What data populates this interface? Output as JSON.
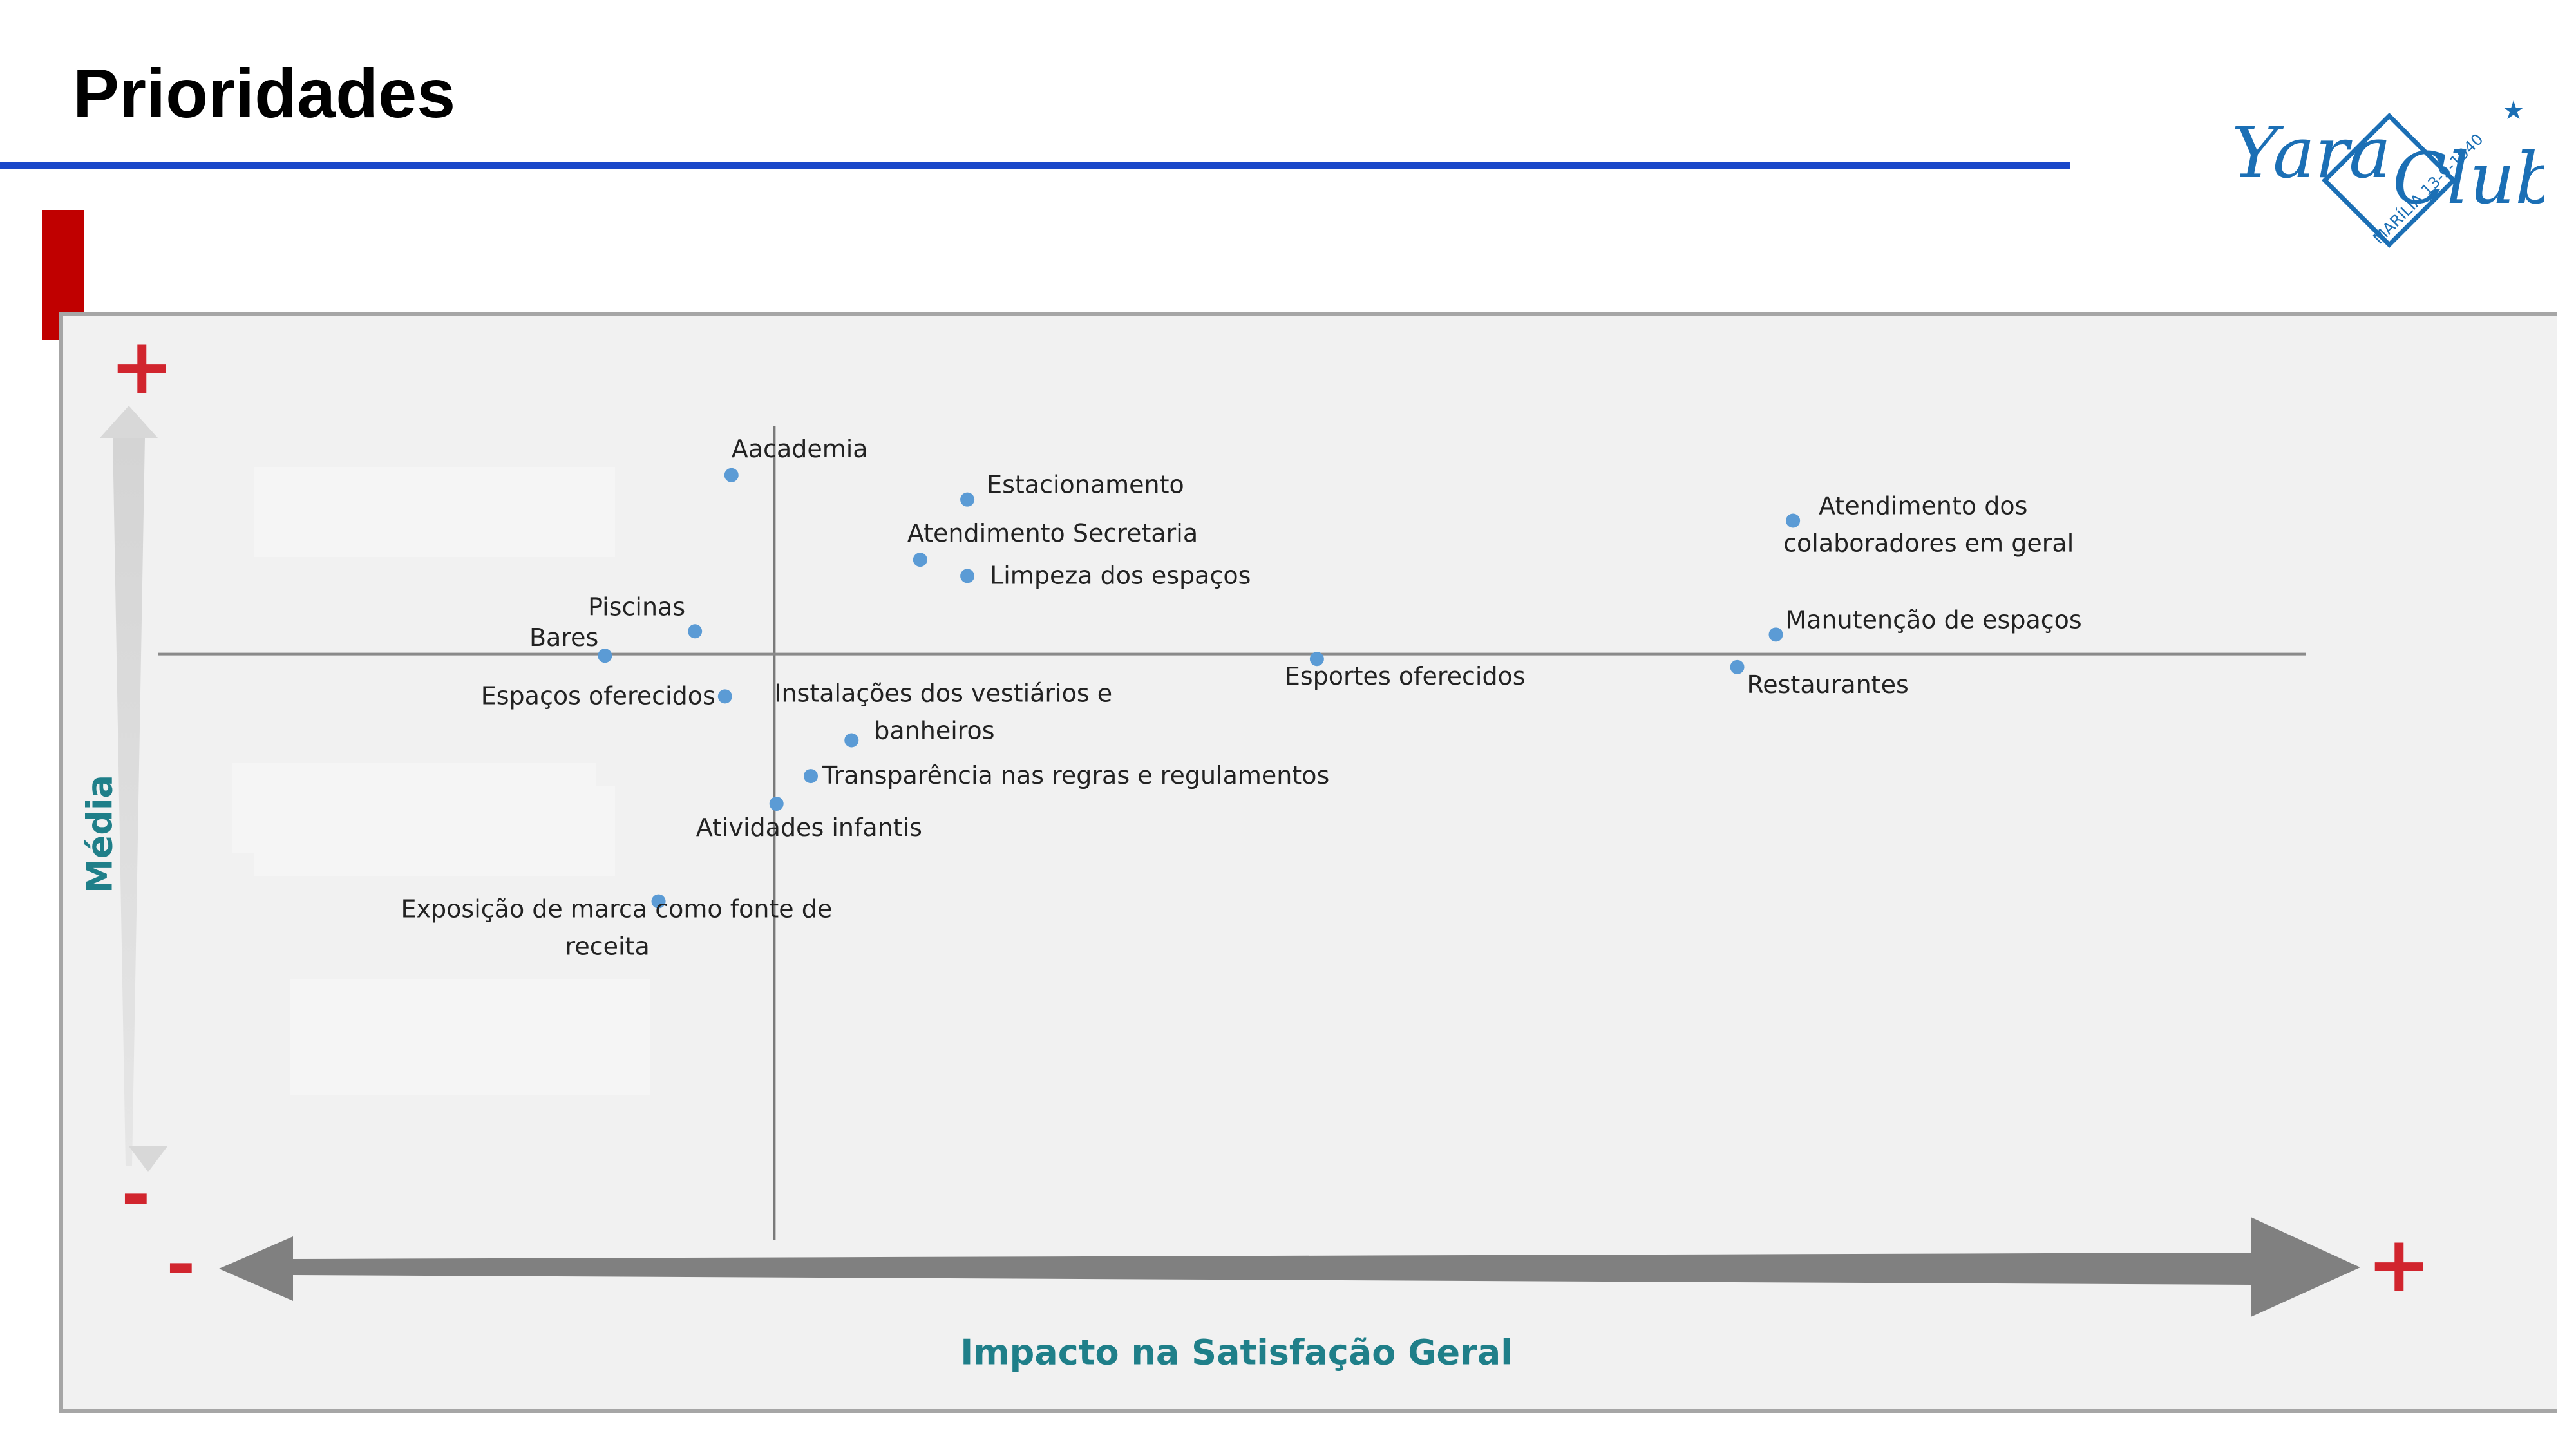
{
  "header": {
    "title": "Prioridades"
  },
  "logo": {
    "text": "Yara Clube",
    "badge_text": "MARÍLIA 13-9-1940"
  },
  "colors": {
    "title_rule": "#1a47c9",
    "accent_bar": "#c00000",
    "axis_label": "#1f7f89",
    "sign_symbols": "#d1252e",
    "points": "#5b9bd5",
    "logo": "#1b6fb5"
  },
  "chart_data": {
    "type": "scatter",
    "title": "",
    "xlabel": "Impacto na Satisfação Geral",
    "ylabel": "Média",
    "x_axis_ends": {
      "low": "-",
      "high": "+"
    },
    "y_axis_ends": {
      "low": "-",
      "high": "+"
    },
    "xlim": [
      0,
      100
    ],
    "ylim": [
      0,
      100
    ],
    "reference_lines": {
      "x": 28.6,
      "y": 72
    },
    "legend": "none",
    "grid": false,
    "points": [
      {
        "label": "Aacademia",
        "x": 26.6,
        "y": 94
      },
      {
        "label": "Estacionamento",
        "x": 37.6,
        "y": 91
      },
      {
        "label": "Atendimento Secretaria",
        "x": 35.4,
        "y": 83.6
      },
      {
        "label": "Limpeza dos espaços",
        "x": 37.6,
        "y": 81.6
      },
      {
        "label": "Atendimento dos colaboradores em geral",
        "x": 76.1,
        "y": 88.4
      },
      {
        "label": "Piscinas",
        "x": 24.9,
        "y": 74.8
      },
      {
        "label": "Bares",
        "x": 20.7,
        "y": 71.8
      },
      {
        "label": "Manutenção de espaços",
        "x": 75.3,
        "y": 74.4
      },
      {
        "label": "Esportes oferecidos",
        "x": 53.9,
        "y": 71.4
      },
      {
        "label": "Restaurantes",
        "x": 73.5,
        "y": 70.4
      },
      {
        "label": "Espaços oferecidos",
        "x": 26.3,
        "y": 66.8
      },
      {
        "label": "Instalações dos vestiários e banheiros",
        "x": 32.2,
        "y": 61.4
      },
      {
        "label": "Transparência nas regras e regulamentos",
        "x": 30.3,
        "y": 57
      },
      {
        "label": "Atividades infantis",
        "x": 28.7,
        "y": 53.6
      },
      {
        "label": "Exposição de marca como fonte de receita",
        "x": 23.2,
        "y": 41.6
      }
    ]
  }
}
